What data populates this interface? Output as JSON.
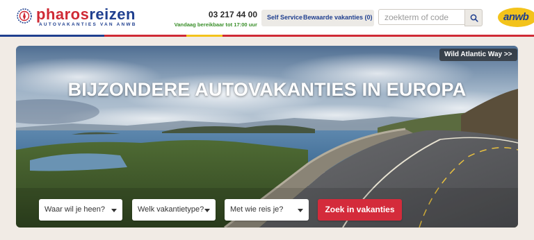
{
  "brand": {
    "name_part1": "pharos",
    "name_part2": "reizen",
    "tagline": "AUTOVAKANTIES VAN ANWB",
    "partner_logo_text": "anwb"
  },
  "contact": {
    "phone": "03 217 44 00",
    "hours": "Vandaag bereikbaar tot 17:00 uur"
  },
  "nav": {
    "self_service": "Self Service",
    "saved_trips": "Bewaarde vakanties (0)"
  },
  "search": {
    "placeholder": "zoekterm of code",
    "button_icon": "search-icon"
  },
  "hero": {
    "title": "BIJZONDERE AUTOVAKANTIES IN EUROPA",
    "badge": "Wild Atlantic Way >>"
  },
  "filters": {
    "destination": "Waar wil je heen?",
    "type": "Welk vakantietype?",
    "company": "Met wie reis je?",
    "submit": "Zoek in vakanties"
  },
  "colors": {
    "brand_red": "#cf2a35",
    "brand_blue": "#1f3f8f",
    "anwb_yellow": "#f3c31b",
    "cta_red": "#d42b3b",
    "background": "#f1ebe5"
  }
}
